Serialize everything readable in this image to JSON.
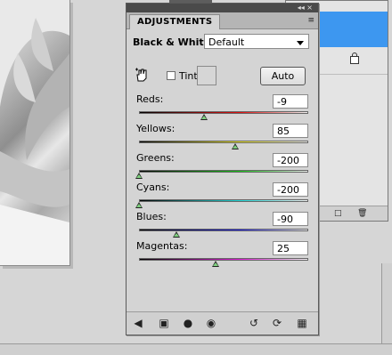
{
  "panel": {
    "tab_label": "ADJUSTMENTS",
    "window_controls": "◂◂ ×",
    "menu_icon": "≡",
    "title": "Black & White",
    "preset": {
      "selected": "Default"
    },
    "tint_label": "Tint",
    "auto_label": "Auto"
  },
  "sliders": [
    {
      "label": "Reds",
      "value": "-9",
      "num": -9,
      "gradient": [
        "#000000",
        "#e01010"
      ]
    },
    {
      "label": "Yellows",
      "value": "85",
      "num": 85,
      "gradient": [
        "#000000",
        "#e8e020"
      ]
    },
    {
      "label": "Greens",
      "value": "-200",
      "num": -200,
      "gradient": [
        "#000000",
        "#18c018"
      ]
    },
    {
      "label": "Cyans",
      "value": "-200",
      "num": -200,
      "gradient": [
        "#000000",
        "#20d8d8"
      ]
    },
    {
      "label": "Blues",
      "value": "-90",
      "num": -90,
      "gradient": [
        "#000000",
        "#2020e0"
      ]
    },
    {
      "label": "Magentas",
      "value": "25",
      "num": 25,
      "gradient": [
        "#000000",
        "#e020d8"
      ]
    }
  ],
  "slider_range": [
    -200,
    300
  ],
  "footer_icons": [
    "back-arrow-icon",
    "clip-to-layer-icon",
    "layer-mask-icon",
    "visibility-eye-icon",
    "view-previous-state-icon",
    "reset-icon",
    "trash-icon"
  ],
  "colors": {
    "selection": "#3d97f0",
    "panel_bg": "#d4d4d4"
  }
}
